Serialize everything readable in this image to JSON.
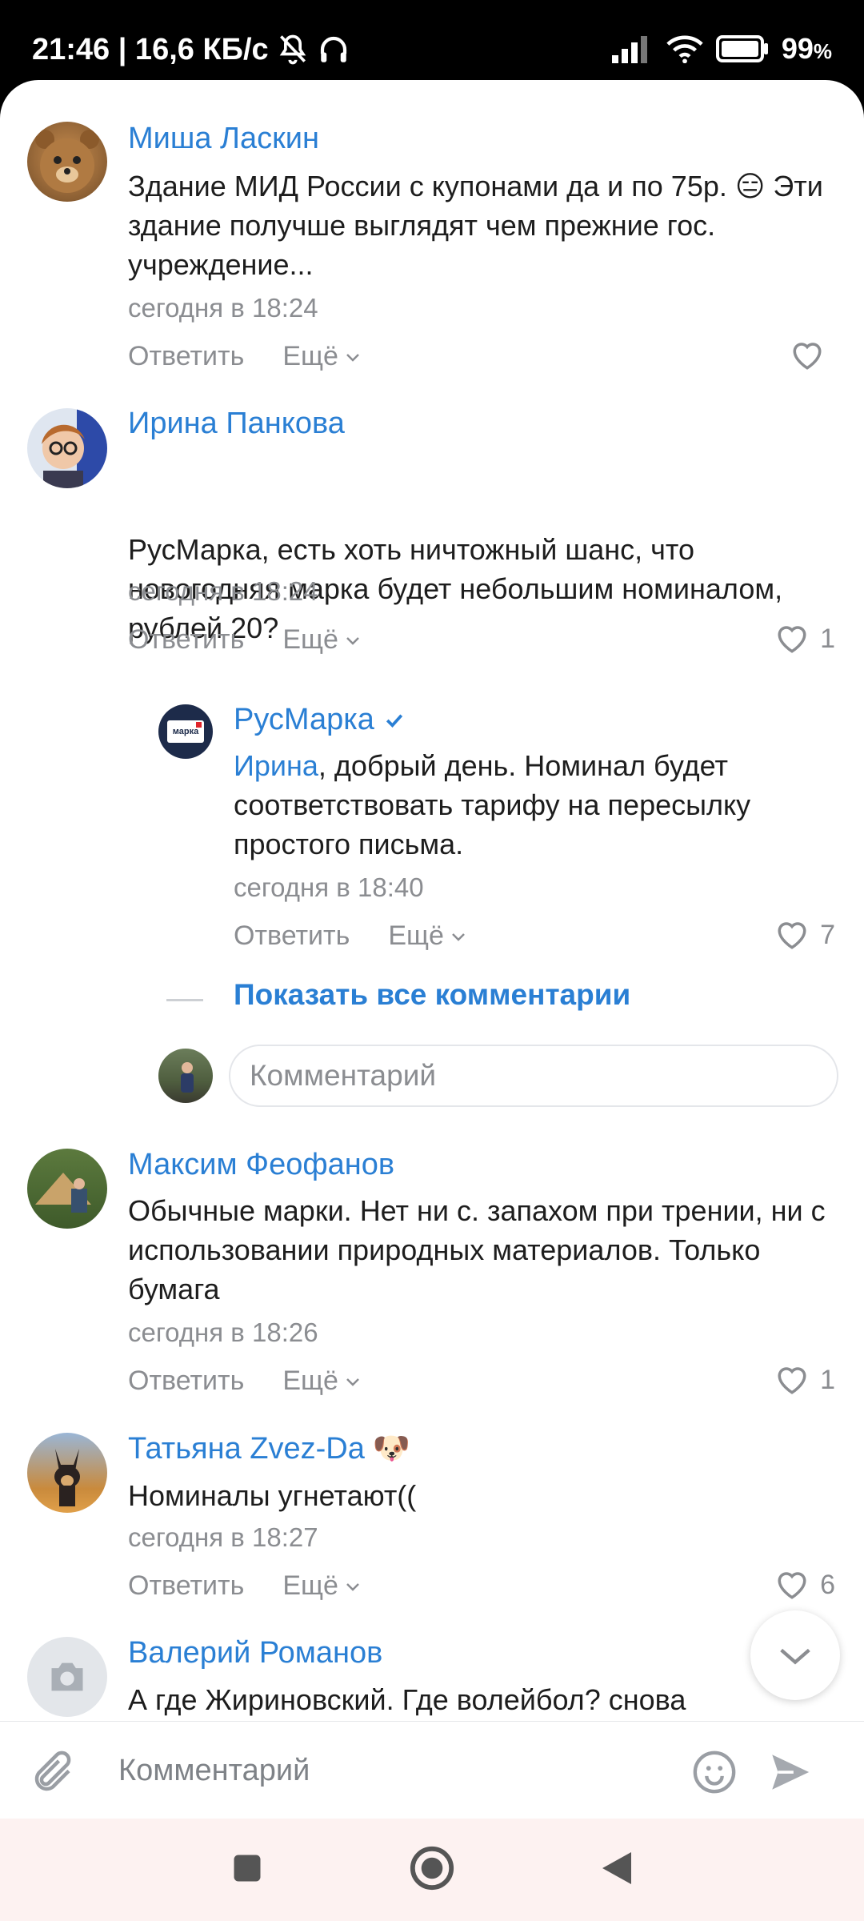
{
  "status_bar": {
    "time_speed": "21:46 | 16,6 КБ/с",
    "battery": "99",
    "battery_unit": "%"
  },
  "comments": [
    {
      "author": "Миша Ласкин",
      "text": "Здание МИД России с купонами да и по 75р. 😑 Эти здание получше выглядят чем прежние гос. учреждение...",
      "time": "сегодня в 18:24",
      "reply": "Ответить",
      "more": "Ещё",
      "likes": ""
    },
    {
      "author": "Ирина Панкова",
      "text": "РусМарка, есть хоть ничтожный шанс, что новогодняя марка будет небольшим номиналом, рублей 20?",
      "time": "сегодня в 18:24",
      "reply": "Ответить",
      "more": "Ещё",
      "likes": "1"
    },
    {
      "author": "РусМарка",
      "mention": "Ирина",
      "text": ", добрый день. Номинал будет соответствовать тарифу на пересылку простого письма.",
      "time": "сегодня в 18:40",
      "reply": "Ответить",
      "more": "Ещё",
      "likes": "7",
      "avatar_text": "марка"
    },
    {
      "author": "Максим Феофанов",
      "text": "Обычные марки. Нет ни с. запахом при трении, ни с использовании природных материалов. Только бумага",
      "time": "сегодня в 18:26",
      "reply": "Ответить",
      "more": "Ещё",
      "likes": "1"
    },
    {
      "author": "Татьяна Zvez-Da",
      "author_emoji": "🐶",
      "text": "Номиналы угнетают((",
      "time": "сегодня в 18:27",
      "reply": "Ответить",
      "more": "Ещё",
      "likes": "6"
    },
    {
      "author": "Валерий Романов",
      "text": "А где Жириновский. Где волейбол? снова"
    }
  ],
  "thread": {
    "show_all": "Показать все комментарии",
    "reply_placeholder": "Комментарий"
  },
  "bottom_bar": {
    "placeholder": "Комментарий"
  },
  "colors": {
    "link": "#2a7fd4",
    "muted": "#8b8d91",
    "text": "#1d1d1d",
    "navbar": "#fdf2f1"
  }
}
